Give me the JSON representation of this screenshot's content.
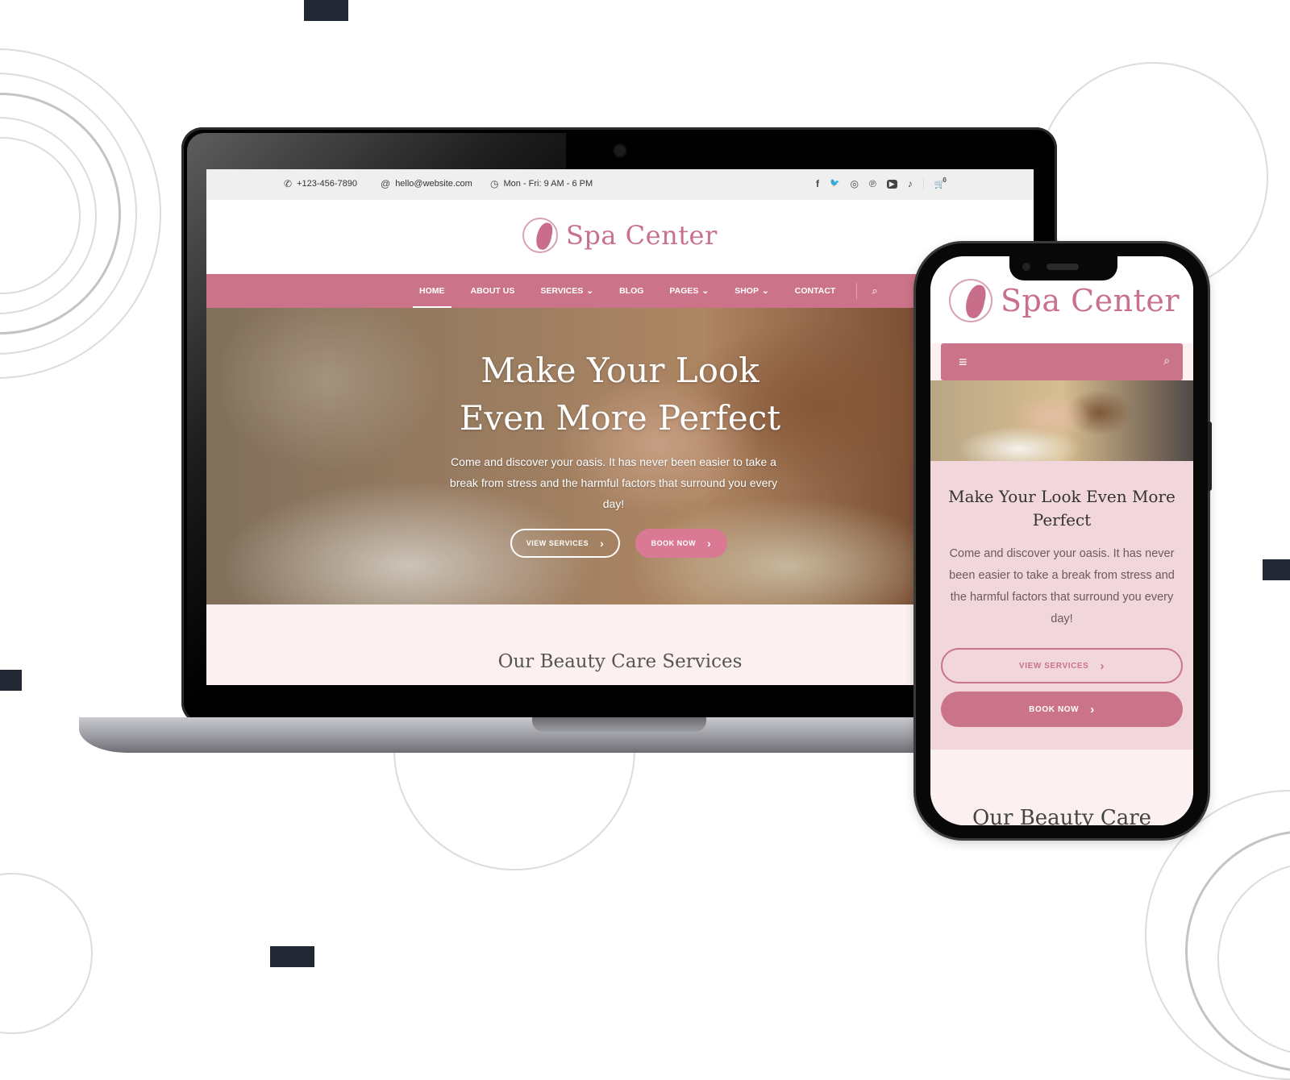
{
  "desktop": {
    "topbar": {
      "phone": "+123-456-7890",
      "email": "hello@website.com",
      "hours": "Mon - Fri: 9 AM - 6 PM",
      "social_icons": [
        "facebook-icon",
        "twitter-icon",
        "instagram-icon",
        "pinterest-icon",
        "youtube-icon",
        "tiktok-icon"
      ],
      "cart_count": "0"
    },
    "header": {
      "logo_text": "Spa Center"
    },
    "nav": {
      "items": [
        {
          "label": "HOME",
          "active": true,
          "dropdown": false
        },
        {
          "label": "ABOUT US",
          "active": false,
          "dropdown": false
        },
        {
          "label": "SERVICES",
          "active": false,
          "dropdown": true
        },
        {
          "label": "BLOG",
          "active": false,
          "dropdown": false
        },
        {
          "label": "PAGES",
          "active": false,
          "dropdown": true
        },
        {
          "label": "SHOP",
          "active": false,
          "dropdown": true
        },
        {
          "label": "CONTACT",
          "active": false,
          "dropdown": false
        }
      ]
    },
    "hero": {
      "title_line1": "Make Your Look",
      "title_line2": "Even More Perfect",
      "text": "Come and discover your oasis. It has never been easier to take a break from stress and the harmful factors that surround you every day!",
      "btn_view_services": "VIEW SERVICES",
      "btn_book_now": "BOOK NOW"
    },
    "services": {
      "title": "Our Beauty Care Services"
    }
  },
  "mobile": {
    "header": {
      "logo_text": "Spa Center"
    },
    "hero": {
      "title": "Make Your Look Even More Perfect",
      "text": "Come and discover your oasis. It has never been easier to take a break from stress and the harmful factors that surround you every day!",
      "btn_view_services": "VIEW SERVICES",
      "btn_book_now": "BOOK NOW"
    },
    "services": {
      "title": "Our Beauty Care"
    }
  },
  "glyphs": {
    "phone": "✆",
    "at": "@",
    "clock": "◷",
    "facebook": "f",
    "twitter": "🐦",
    "instagram": "◎",
    "pinterest": "℗",
    "youtube": "▶",
    "tiktok": "♪",
    "cart": "🛒",
    "search": "⌕",
    "chevron_down": "⌄",
    "chevron_right": "›",
    "menu": "≡"
  },
  "colors": {
    "brand_pink": "#cb7389",
    "button_pink": "#d97994",
    "topbar_bg": "#efefef",
    "section_bg": "#fcf0f1",
    "mobile_hero_bg": "#f1d6dc",
    "deco_dark": "#212833"
  }
}
